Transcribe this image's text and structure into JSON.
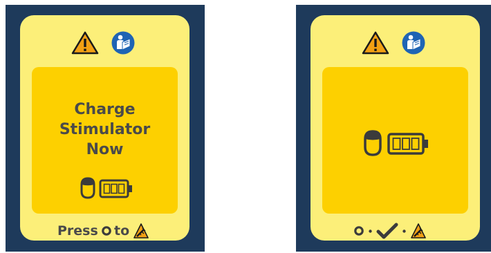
{
  "left_screen": {
    "message": [
      "Charge",
      "Stimulator",
      "Now"
    ],
    "footer": {
      "press_label": "Press",
      "to_label": "to"
    }
  },
  "right_screen": {
    "footer_sequence": [
      "center-button-icon",
      "checkmark-icon",
      "remote-icon"
    ]
  },
  "icons": {
    "header": [
      "warning-icon",
      "consult-manual-icon"
    ],
    "status": [
      "head-icon",
      "battery-icon"
    ]
  },
  "colors": {
    "panel_border": "#1e3a5b",
    "screen": "#fcef79",
    "inner": "#fdd000",
    "text": "#4a4a4a",
    "manual_icon": "#1f64b4",
    "warning": "#f2a013"
  }
}
